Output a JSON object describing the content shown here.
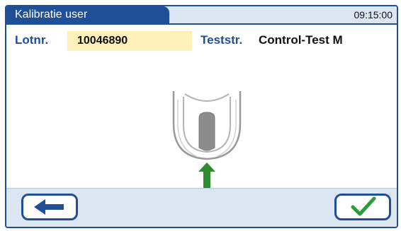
{
  "header": {
    "title": "Kalibratie user",
    "time": "09:15:00"
  },
  "info": {
    "lot_label": "Lotnr.",
    "lot_value": "10046890",
    "test_label": "Teststr.",
    "test_value": "Control-Test M"
  },
  "illustration": {
    "icon": "insert-test-strip-icon",
    "arrow_icon": "arrow-up-icon",
    "arrow_color": "#2e8b2e"
  },
  "footer": {
    "back_icon": "arrow-left-icon",
    "confirm_icon": "checkmark-icon",
    "check_color": "#2e9b3a"
  },
  "colors": {
    "accent": "#1f4f96",
    "bar_background": "#dce6f2",
    "lot_highlight": "#fdf0b8"
  }
}
